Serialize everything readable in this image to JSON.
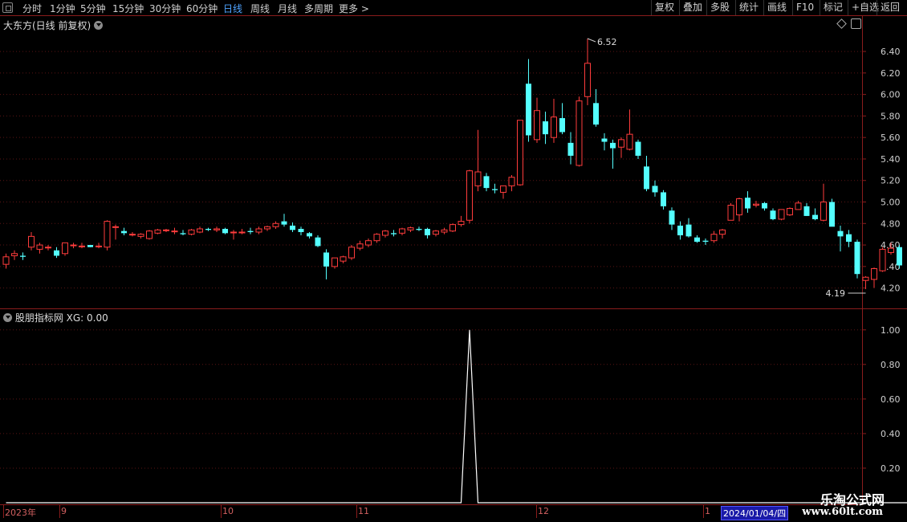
{
  "toolbar": {
    "periods": [
      {
        "label": "分时",
        "active": false
      },
      {
        "label": "1分钟",
        "active": false
      },
      {
        "label": "5分钟",
        "active": false
      },
      {
        "label": "15分钟",
        "active": false
      },
      {
        "label": "30分钟",
        "active": false
      },
      {
        "label": "60分钟",
        "active": false
      },
      {
        "label": "日线",
        "active": true
      },
      {
        "label": "周线",
        "active": false
      },
      {
        "label": "月线",
        "active": false
      },
      {
        "label": "多周期",
        "active": false
      },
      {
        "label": "更多 >",
        "active": false
      }
    ],
    "right_buttons": [
      "复权",
      "叠加",
      "多股",
      "统计",
      "画线",
      "F10",
      "标记",
      "+自选",
      "返回"
    ]
  },
  "main_panel": {
    "title": "大东方(日线 前复权)",
    "y_ticks": [
      "6.40",
      "6.20",
      "6.00",
      "5.80",
      "5.60",
      "5.40",
      "5.20",
      "5.00",
      "4.80",
      "4.60",
      "4.40",
      "4.20"
    ],
    "high_label": "6.52",
    "low_label": "4.19"
  },
  "indicator_panel": {
    "title": "股朋指标网  XG: 0.00",
    "y_ticks": [
      "1.00",
      "0.80",
      "0.60",
      "0.40",
      "0.20"
    ]
  },
  "x_axis": {
    "labels": [
      "2023年",
      "9",
      "10",
      "11",
      "12",
      "1"
    ],
    "current_date": "2024/01/04/四"
  },
  "watermark": {
    "line1": "乐淘公式网",
    "line2": "www.60lt.com"
  },
  "colors": {
    "up": "#ff3c3c",
    "down": "#54ffff",
    "grid": "#5a1414",
    "frame": "#8a1c1c",
    "active": "#4fa3ff"
  },
  "chart_data": [
    {
      "type": "candlestick",
      "title": "大东方(日线 前复权)",
      "ylim": [
        4.1,
        6.55
      ],
      "y_ticks": [
        6.4,
        6.2,
        6.0,
        5.8,
        5.6,
        5.4,
        5.2,
        5.0,
        4.8,
        4.6,
        4.4,
        4.2
      ],
      "ohlc": [
        [
          4.42,
          4.52,
          4.38,
          4.49
        ],
        [
          4.5,
          4.55,
          4.46,
          4.52
        ],
        [
          4.5,
          4.53,
          4.46,
          4.49
        ],
        [
          4.58,
          4.72,
          4.55,
          4.68
        ],
        [
          4.56,
          4.62,
          4.52,
          4.6
        ],
        [
          4.58,
          4.6,
          4.55,
          4.58
        ],
        [
          4.55,
          4.58,
          4.48,
          4.5
        ],
        [
          4.52,
          4.62,
          4.5,
          4.62
        ],
        [
          4.6,
          4.62,
          4.57,
          4.6
        ],
        [
          4.59,
          4.62,
          4.57,
          4.59
        ],
        [
          4.6,
          4.6,
          4.58,
          4.58
        ],
        [
          4.59,
          4.62,
          4.57,
          4.59
        ],
        [
          4.58,
          4.83,
          4.55,
          4.82
        ],
        [
          4.77,
          4.79,
          4.65,
          4.77
        ],
        [
          4.73,
          4.76,
          4.69,
          4.71
        ],
        [
          4.7,
          4.72,
          4.68,
          4.7
        ],
        [
          4.68,
          4.71,
          4.66,
          4.7
        ],
        [
          4.66,
          4.74,
          4.65,
          4.73
        ],
        [
          4.71,
          4.75,
          4.7,
          4.74
        ],
        [
          4.74,
          4.75,
          4.72,
          4.74
        ],
        [
          4.73,
          4.76,
          4.7,
          4.73
        ],
        [
          4.71,
          4.74,
          4.69,
          4.7
        ],
        [
          4.7,
          4.75,
          4.69,
          4.74
        ],
        [
          4.72,
          4.77,
          4.71,
          4.75
        ],
        [
          4.75,
          4.76,
          4.73,
          4.74
        ],
        [
          4.74,
          4.77,
          4.72,
          4.75
        ],
        [
          4.75,
          4.76,
          4.7,
          4.71
        ],
        [
          4.72,
          4.74,
          4.65,
          4.72
        ],
        [
          4.72,
          4.75,
          4.7,
          4.72
        ],
        [
          4.73,
          4.76,
          4.7,
          4.72
        ],
        [
          4.72,
          4.77,
          4.7,
          4.75
        ],
        [
          4.75,
          4.78,
          4.73,
          4.77
        ],
        [
          4.77,
          4.82,
          4.75,
          4.8
        ],
        [
          4.82,
          4.89,
          4.77,
          4.79
        ],
        [
          4.78,
          4.81,
          4.72,
          4.74
        ],
        [
          4.75,
          4.77,
          4.69,
          4.72
        ],
        [
          4.71,
          4.72,
          4.66,
          4.68
        ],
        [
          4.67,
          4.69,
          4.58,
          4.59
        ],
        [
          4.53,
          4.56,
          4.28,
          4.4
        ],
        [
          4.4,
          4.48,
          4.38,
          4.48
        ],
        [
          4.45,
          4.5,
          4.43,
          4.49
        ],
        [
          4.48,
          4.6,
          4.46,
          4.58
        ],
        [
          4.57,
          4.64,
          4.55,
          4.61
        ],
        [
          4.6,
          4.66,
          4.58,
          4.64
        ],
        [
          4.64,
          4.71,
          4.62,
          4.7
        ],
        [
          4.69,
          4.74,
          4.67,
          4.73
        ],
        [
          4.71,
          4.74,
          4.68,
          4.7
        ],
        [
          4.71,
          4.76,
          4.69,
          4.75
        ],
        [
          4.74,
          4.77,
          4.72,
          4.76
        ],
        [
          4.75,
          4.77,
          4.73,
          4.74
        ],
        [
          4.75,
          4.76,
          4.66,
          4.69
        ],
        [
          4.7,
          4.74,
          4.68,
          4.73
        ],
        [
          4.72,
          4.76,
          4.7,
          4.74
        ],
        [
          4.73,
          4.8,
          4.72,
          4.79
        ],
        [
          4.79,
          4.87,
          4.77,
          4.82
        ],
        [
          4.83,
          5.3,
          4.8,
          5.29
        ],
        [
          5.15,
          5.67,
          5.1,
          5.28
        ],
        [
          5.24,
          5.27,
          5.1,
          5.13
        ],
        [
          5.12,
          5.17,
          5.08,
          5.11
        ],
        [
          5.09,
          5.12,
          5.03,
          5.15
        ],
        [
          5.15,
          5.25,
          5.1,
          5.23
        ],
        [
          5.16,
          5.76,
          5.15,
          5.76
        ],
        [
          6.1,
          6.33,
          5.56,
          5.62
        ],
        [
          5.58,
          5.97,
          5.55,
          5.85
        ],
        [
          5.75,
          5.84,
          5.54,
          5.63
        ],
        [
          5.6,
          5.96,
          5.55,
          5.79
        ],
        [
          5.78,
          5.92,
          5.63,
          5.65
        ],
        [
          5.55,
          5.65,
          5.35,
          5.43
        ],
        [
          5.34,
          5.98,
          5.33,
          5.94
        ],
        [
          5.98,
          6.52,
          5.9,
          6.29
        ],
        [
          5.92,
          6.05,
          5.7,
          5.72
        ],
        [
          5.59,
          5.64,
          5.48,
          5.56
        ],
        [
          5.55,
          5.58,
          5.31,
          5.5
        ],
        [
          5.51,
          5.6,
          5.41,
          5.58
        ],
        [
          5.49,
          5.86,
          5.48,
          5.63
        ],
        [
          5.56,
          5.58,
          5.4,
          5.43
        ],
        [
          5.33,
          5.43,
          5.1,
          5.12
        ],
        [
          5.15,
          5.2,
          5.05,
          5.09
        ],
        [
          5.09,
          5.11,
          4.93,
          4.96
        ],
        [
          4.92,
          4.95,
          4.74,
          4.79
        ],
        [
          4.78,
          4.82,
          4.65,
          4.69
        ],
        [
          4.79,
          4.85,
          4.67,
          4.68
        ],
        [
          4.67,
          4.69,
          4.62,
          4.63
        ],
        [
          4.64,
          4.66,
          4.6,
          4.63
        ],
        [
          4.64,
          4.73,
          4.62,
          4.7
        ],
        [
          4.7,
          4.75,
          4.66,
          4.74
        ],
        [
          4.83,
          4.99,
          4.83,
          4.97
        ],
        [
          4.88,
          5.04,
          4.82,
          5.03
        ],
        [
          5.04,
          5.1,
          4.9,
          4.94
        ],
        [
          4.97,
          5.01,
          4.95,
          4.98
        ],
        [
          4.99,
          5.0,
          4.92,
          4.94
        ],
        [
          4.92,
          4.94,
          4.83,
          4.84
        ],
        [
          4.84,
          4.93,
          4.83,
          4.93
        ],
        [
          4.88,
          4.95,
          4.87,
          4.94
        ],
        [
          4.93,
          5.01,
          4.93,
          4.99
        ],
        [
          4.96,
          4.99,
          4.87,
          4.87
        ],
        [
          4.88,
          4.94,
          4.83,
          4.84
        ],
        [
          4.83,
          5.17,
          4.82,
          5.0
        ],
        [
          5.0,
          5.03,
          4.8,
          4.77
        ],
        [
          4.73,
          4.78,
          4.54,
          4.68
        ],
        [
          4.7,
          4.74,
          4.58,
          4.63
        ],
        [
          4.63,
          4.65,
          4.29,
          4.33
        ],
        [
          4.27,
          4.31,
          4.19,
          4.3
        ],
        [
          4.28,
          4.39,
          4.2,
          4.38
        ],
        [
          4.36,
          4.58,
          4.35,
          4.56
        ],
        [
          4.53,
          4.62,
          4.51,
          4.57
        ],
        [
          4.58,
          4.6,
          4.38,
          4.41
        ]
      ]
    },
    {
      "type": "line",
      "title": "股朋指标网  XG: 0.00",
      "ylim": [
        0,
        1.05
      ],
      "y_ticks": [
        1.0,
        0.8,
        0.6,
        0.4,
        0.2
      ],
      "spike_index": 55,
      "count": 108
    }
  ]
}
